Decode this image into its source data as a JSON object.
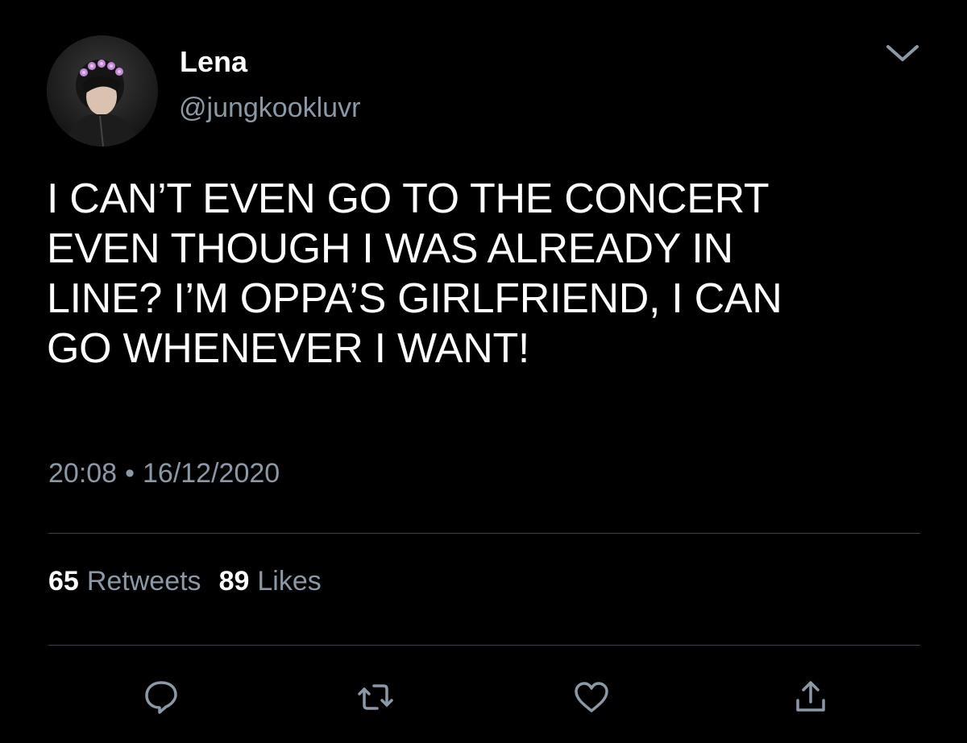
{
  "user": {
    "display_name": "Lena",
    "handle": "@jungkookluvr"
  },
  "tweet": {
    "text": "I CAN’T EVEN GO TO THE CONCERT\nEVEN THOUGH I WAS ALREADY IN\nLINE? I’M OPPA’S GIRLFRIEND, I CAN\nGO WHENEVER I WANT!",
    "time": "20:08",
    "separator": "•",
    "date": "16/12/2020"
  },
  "stats": {
    "retweets_count": "65",
    "retweets_label": "Retweets",
    "likes_count": "89",
    "likes_label": "Likes"
  },
  "icons": {
    "menu": "chevron-down-icon",
    "reply": "reply-icon",
    "retweet": "retweet-icon",
    "like": "heart-icon",
    "share": "share-icon"
  },
  "colors": {
    "background": "#000000",
    "primary_text": "#ffffff",
    "secondary_text": "#8b98a5",
    "divider": "#38444d"
  }
}
